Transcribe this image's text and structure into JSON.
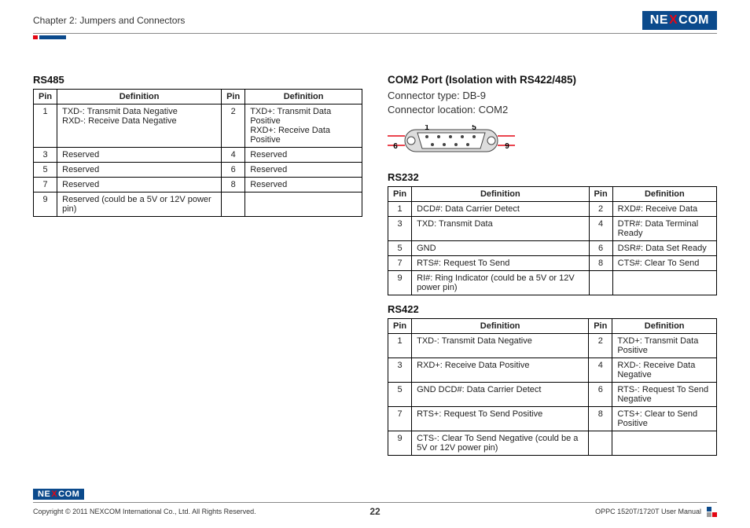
{
  "header": {
    "chapter": "Chapter 2: Jumpers and Connectors",
    "logo_pre": "NE",
    "logo_x": "X",
    "logo_post": "COM"
  },
  "rs485": {
    "heading": "RS485",
    "th_pin": "Pin",
    "th_def": "Definition",
    "rows": [
      {
        "p1": "1",
        "d1": "TXD-: Transmit Data Negative\nRXD-: Receive Data Negative",
        "p2": "2",
        "d2": "TXD+: Transmit Data Positive\nRXD+: Receive Data Positive"
      },
      {
        "p1": "3",
        "d1": "Reserved",
        "p2": "4",
        "d2": "Reserved"
      },
      {
        "p1": "5",
        "d1": "Reserved",
        "p2": "6",
        "d2": "Reserved"
      },
      {
        "p1": "7",
        "d1": "Reserved",
        "p2": "8",
        "d2": "Reserved"
      },
      {
        "p1": "9",
        "d1": "Reserved (could be a 5V or 12V power pin)",
        "p2": "",
        "d2": ""
      }
    ]
  },
  "com2": {
    "heading": "COM2 Port (Isolation with RS422/485)",
    "line1": "Connector type: DB-9",
    "line2": "Connector location: COM2",
    "n1": "1",
    "n5": "5",
    "n6": "6",
    "n9": "9"
  },
  "rs232": {
    "heading": "RS232",
    "th_pin": "Pin",
    "th_def": "Definition",
    "rows": [
      {
        "p1": "1",
        "d1": "DCD#: Data Carrier Detect",
        "p2": "2",
        "d2": "RXD#: Receive Data"
      },
      {
        "p1": "3",
        "d1": "TXD: Transmit Data",
        "p2": "4",
        "d2": "DTR#: Data Terminal Ready"
      },
      {
        "p1": "5",
        "d1": "GND",
        "p2": "6",
        "d2": "DSR#: Data Set Ready"
      },
      {
        "p1": "7",
        "d1": "RTS#: Request To Send",
        "p2": "8",
        "d2": "CTS#: Clear To Send"
      },
      {
        "p1": "9",
        "d1": "RI#: Ring Indicator (could be a 5V or 12V power pin)",
        "p2": "",
        "d2": ""
      }
    ]
  },
  "rs422": {
    "heading": "RS422",
    "th_pin": "Pin",
    "th_def": "Definition",
    "rows": [
      {
        "p1": "1",
        "d1": "TXD-: Transmit Data Negative",
        "p2": "2",
        "d2": "TXD+: Transmit Data Positive"
      },
      {
        "p1": "3",
        "d1": "RXD+: Receive Data Positive",
        "p2": "4",
        "d2": "RXD-: Receive Data Negative"
      },
      {
        "p1": "5",
        "d1": "GND DCD#: Data Carrier Detect",
        "p2": "6",
        "d2": "RTS-: Request To Send Negative"
      },
      {
        "p1": "7",
        "d1": "RTS+: Request To Send Positive",
        "p2": "8",
        "d2": "CTS+: Clear to Send Positive"
      },
      {
        "p1": "9",
        "d1": "CTS-: Clear To Send Negative (could be a 5V or 12V power pin)",
        "p2": "",
        "d2": ""
      }
    ]
  },
  "footer": {
    "copyright": "Copyright © 2011 NEXCOM International Co., Ltd. All Rights Reserved.",
    "page": "22",
    "manual": "OPPC 1520T/1720T User Manual"
  }
}
